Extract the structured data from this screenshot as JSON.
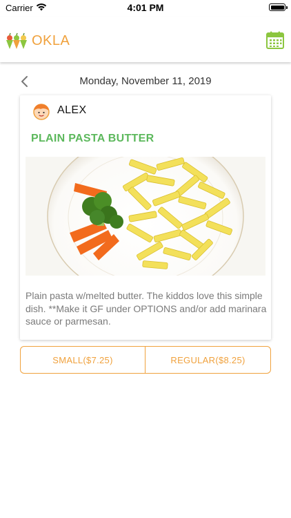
{
  "status_bar": {
    "carrier": "Carrier",
    "time": "4:01 PM",
    "icons": [
      "wifi-icon",
      "battery-icon"
    ]
  },
  "header": {
    "app_name": "OKLA",
    "logo_icon": "okla-logo-icon",
    "calendar_icon": "calendar-icon"
  },
  "date_nav": {
    "back_icon": "chevron-left-icon",
    "date": "Monday, November 11, 2019"
  },
  "meal_card": {
    "child_name": "ALEX",
    "avatar_icon": "child-avatar-icon",
    "meal_title": "PLAIN PASTA BUTTER",
    "image": "plate-of-penne-pasta-with-carrot-and-broccoli",
    "description": "Plain pasta w/melted butter. The kiddos love this simple dish. **Make it GF under OPTIONS and/or add marinara sauce or parmesan."
  },
  "size_options": [
    {
      "label": "SMALL($7.25)"
    },
    {
      "label": "REGULAR($8.25)"
    }
  ],
  "colors": {
    "brand_orange": "#f0a13c",
    "title_green": "#5cb85c",
    "calendar_green": "#8cc63f",
    "description_gray": "#7a7a7a"
  }
}
